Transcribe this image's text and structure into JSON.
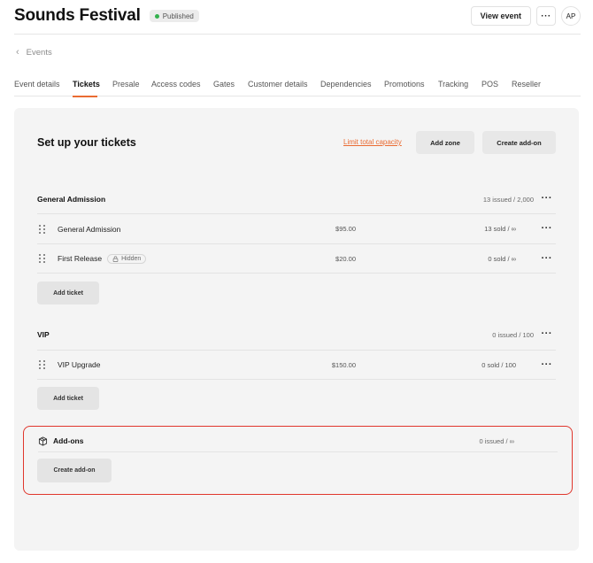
{
  "header": {
    "title": "Sounds Festival",
    "status": "Published",
    "status_color": "#34b14e",
    "view_event_label": "View event",
    "more_icon": "more-horizontal-icon",
    "avatar_initials": "AP"
  },
  "breadcrumb": {
    "back_icon": "chevron-left-icon",
    "label": "Events"
  },
  "tabs": [
    {
      "label": "Event details",
      "active": false
    },
    {
      "label": "Tickets",
      "active": true
    },
    {
      "label": "Presale",
      "active": false
    },
    {
      "label": "Access codes",
      "active": false
    },
    {
      "label": "Gates",
      "active": false
    },
    {
      "label": "Customer details",
      "active": false
    },
    {
      "label": "Dependencies",
      "active": false
    },
    {
      "label": "Promotions",
      "active": false
    },
    {
      "label": "Tracking",
      "active": false
    },
    {
      "label": "POS",
      "active": false
    },
    {
      "label": "Reseller",
      "active": false
    }
  ],
  "accent_color": "#ea6b32",
  "main": {
    "title": "Set up your tickets",
    "limit_capacity_label": "Limit total capacity",
    "add_zone_label": "Add zone",
    "create_addon_label": "Create add-on",
    "zones": [
      {
        "name": "General Admission",
        "count": "13 issued / 2,000",
        "tickets": [
          {
            "name": "General Admission",
            "price": "$95.00",
            "sold": "13 sold / ∞",
            "hidden": false
          },
          {
            "name": "First Release",
            "hidden_label": "Hidden",
            "price": "$20.00",
            "sold": "0 sold / ∞",
            "hidden": true
          }
        ],
        "add_ticket_label": "Add ticket"
      },
      {
        "name": "VIP",
        "count": "0 issued / 100",
        "tickets": [
          {
            "name": "VIP Upgrade",
            "price": "$150.00",
            "sold": "0 sold / 100",
            "hidden": false
          }
        ],
        "add_ticket_label": "Add ticket"
      }
    ],
    "addons": {
      "icon": "package-icon",
      "title": "Add-ons",
      "count": "0 issued / ∞",
      "create_label": "Create add-on",
      "highlight_color": "#e0362c"
    }
  }
}
